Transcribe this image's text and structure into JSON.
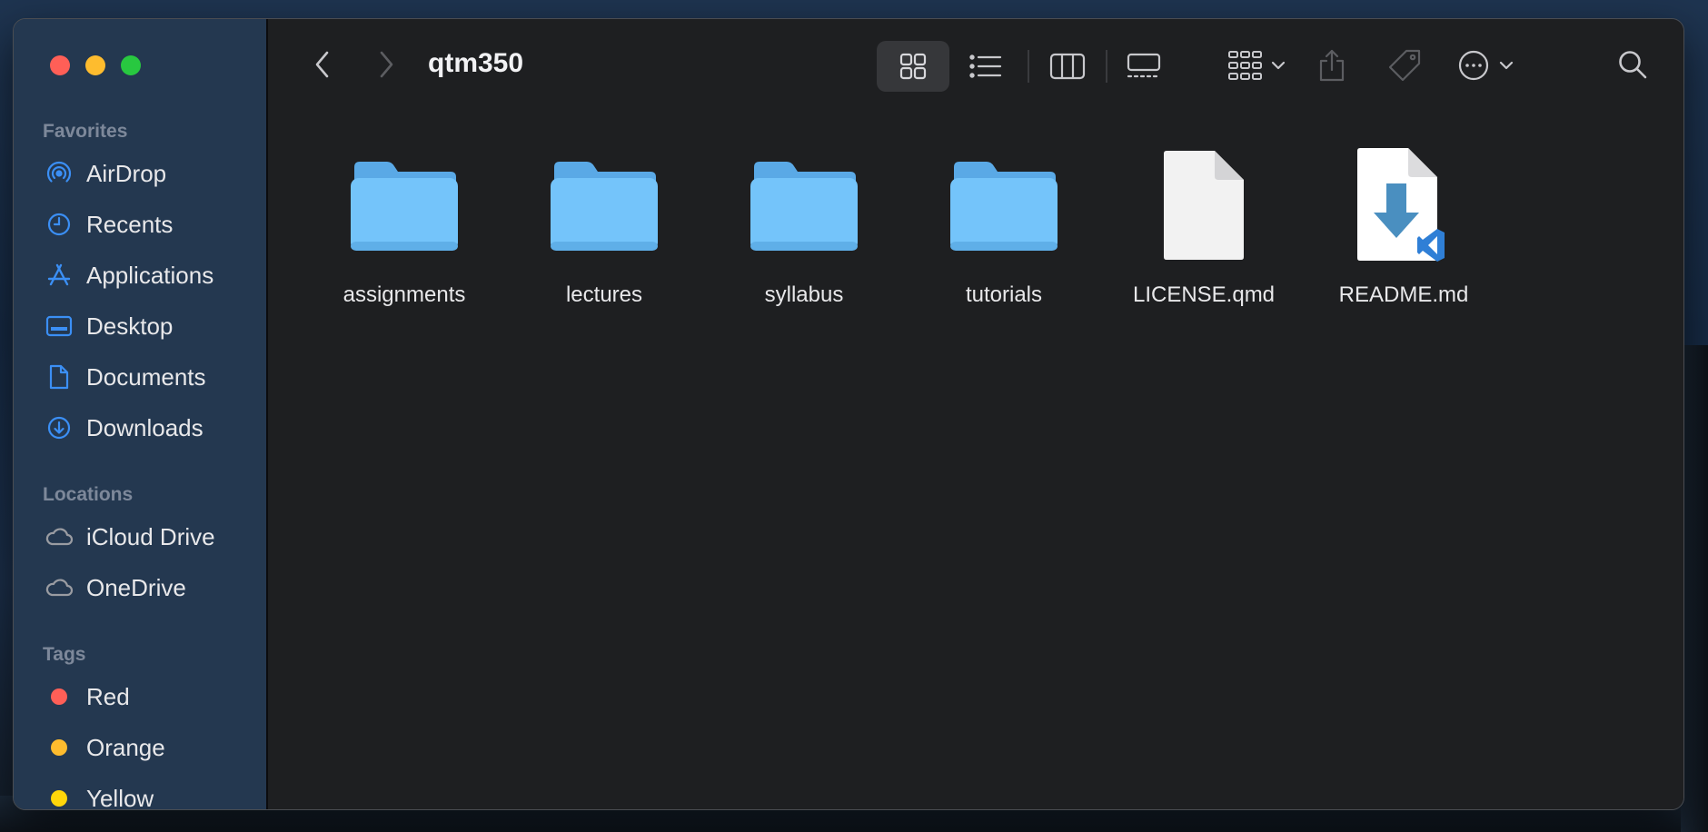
{
  "window": {
    "title": "qtm350"
  },
  "sidebar": {
    "sections": {
      "favorites": "Favorites",
      "locations": "Locations",
      "tags": "Tags"
    },
    "favorites": [
      {
        "label": "AirDrop",
        "icon": "airdrop-icon"
      },
      {
        "label": "Recents",
        "icon": "clock-icon"
      },
      {
        "label": "Applications",
        "icon": "applications-icon"
      },
      {
        "label": "Desktop",
        "icon": "desktop-icon"
      },
      {
        "label": "Documents",
        "icon": "document-icon"
      },
      {
        "label": "Downloads",
        "icon": "download-icon"
      }
    ],
    "locations": [
      {
        "label": "iCloud Drive",
        "icon": "cloud-icon"
      },
      {
        "label": "OneDrive",
        "icon": "cloud-icon"
      }
    ],
    "tags": [
      {
        "label": "Red",
        "color": "#ff5f57"
      },
      {
        "label": "Orange",
        "color": "#febc2e"
      },
      {
        "label": "Yellow",
        "color": "#ffd60a"
      }
    ]
  },
  "files": [
    {
      "name": "assignments",
      "type": "folder"
    },
    {
      "name": "lectures",
      "type": "folder"
    },
    {
      "name": "syllabus",
      "type": "folder"
    },
    {
      "name": "tutorials",
      "type": "folder"
    },
    {
      "name": "LICENSE.qmd",
      "type": "document"
    },
    {
      "name": "README.md",
      "type": "vscode-markdown"
    }
  ],
  "colors": {
    "accent": "#3b8ff5",
    "folder": "#6cbcf2",
    "close": "#ff5f57",
    "minimize": "#febc2e",
    "zoom": "#28c840"
  }
}
